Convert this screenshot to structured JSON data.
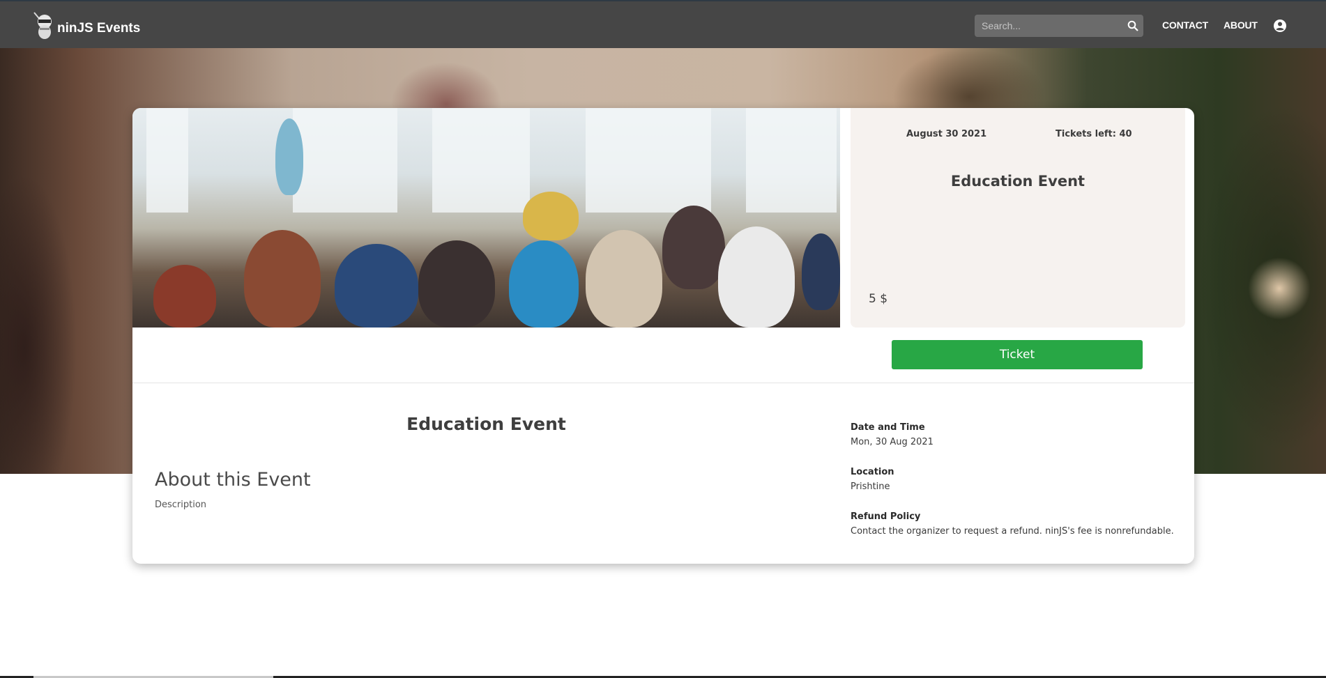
{
  "header": {
    "brand": "ninJS Events",
    "search": {
      "placeholder": "Search..."
    },
    "nav": [
      {
        "label": "CONTACT"
      },
      {
        "label": "ABOUT"
      }
    ],
    "account_icon": "account-circle-icon",
    "background_color": "#464646"
  },
  "event": {
    "date": "August 30 2021",
    "tickets_left": "Tickets left: 40",
    "title": "Education Event",
    "price": "5 $",
    "ticket_button": "Ticket",
    "ticket_button_color": "#28a745"
  },
  "details": {
    "title": "Education Event",
    "about_heading": "About this Event",
    "description": "Description",
    "sections": [
      {
        "label": "Date and Time",
        "value": "Mon, 30 Aug 2021"
      },
      {
        "label": "Location",
        "value": "Prishtine"
      },
      {
        "label": "Refund Policy",
        "value": "Contact the organizer to request a refund. ninJS's fee is nonrefundable."
      }
    ]
  }
}
